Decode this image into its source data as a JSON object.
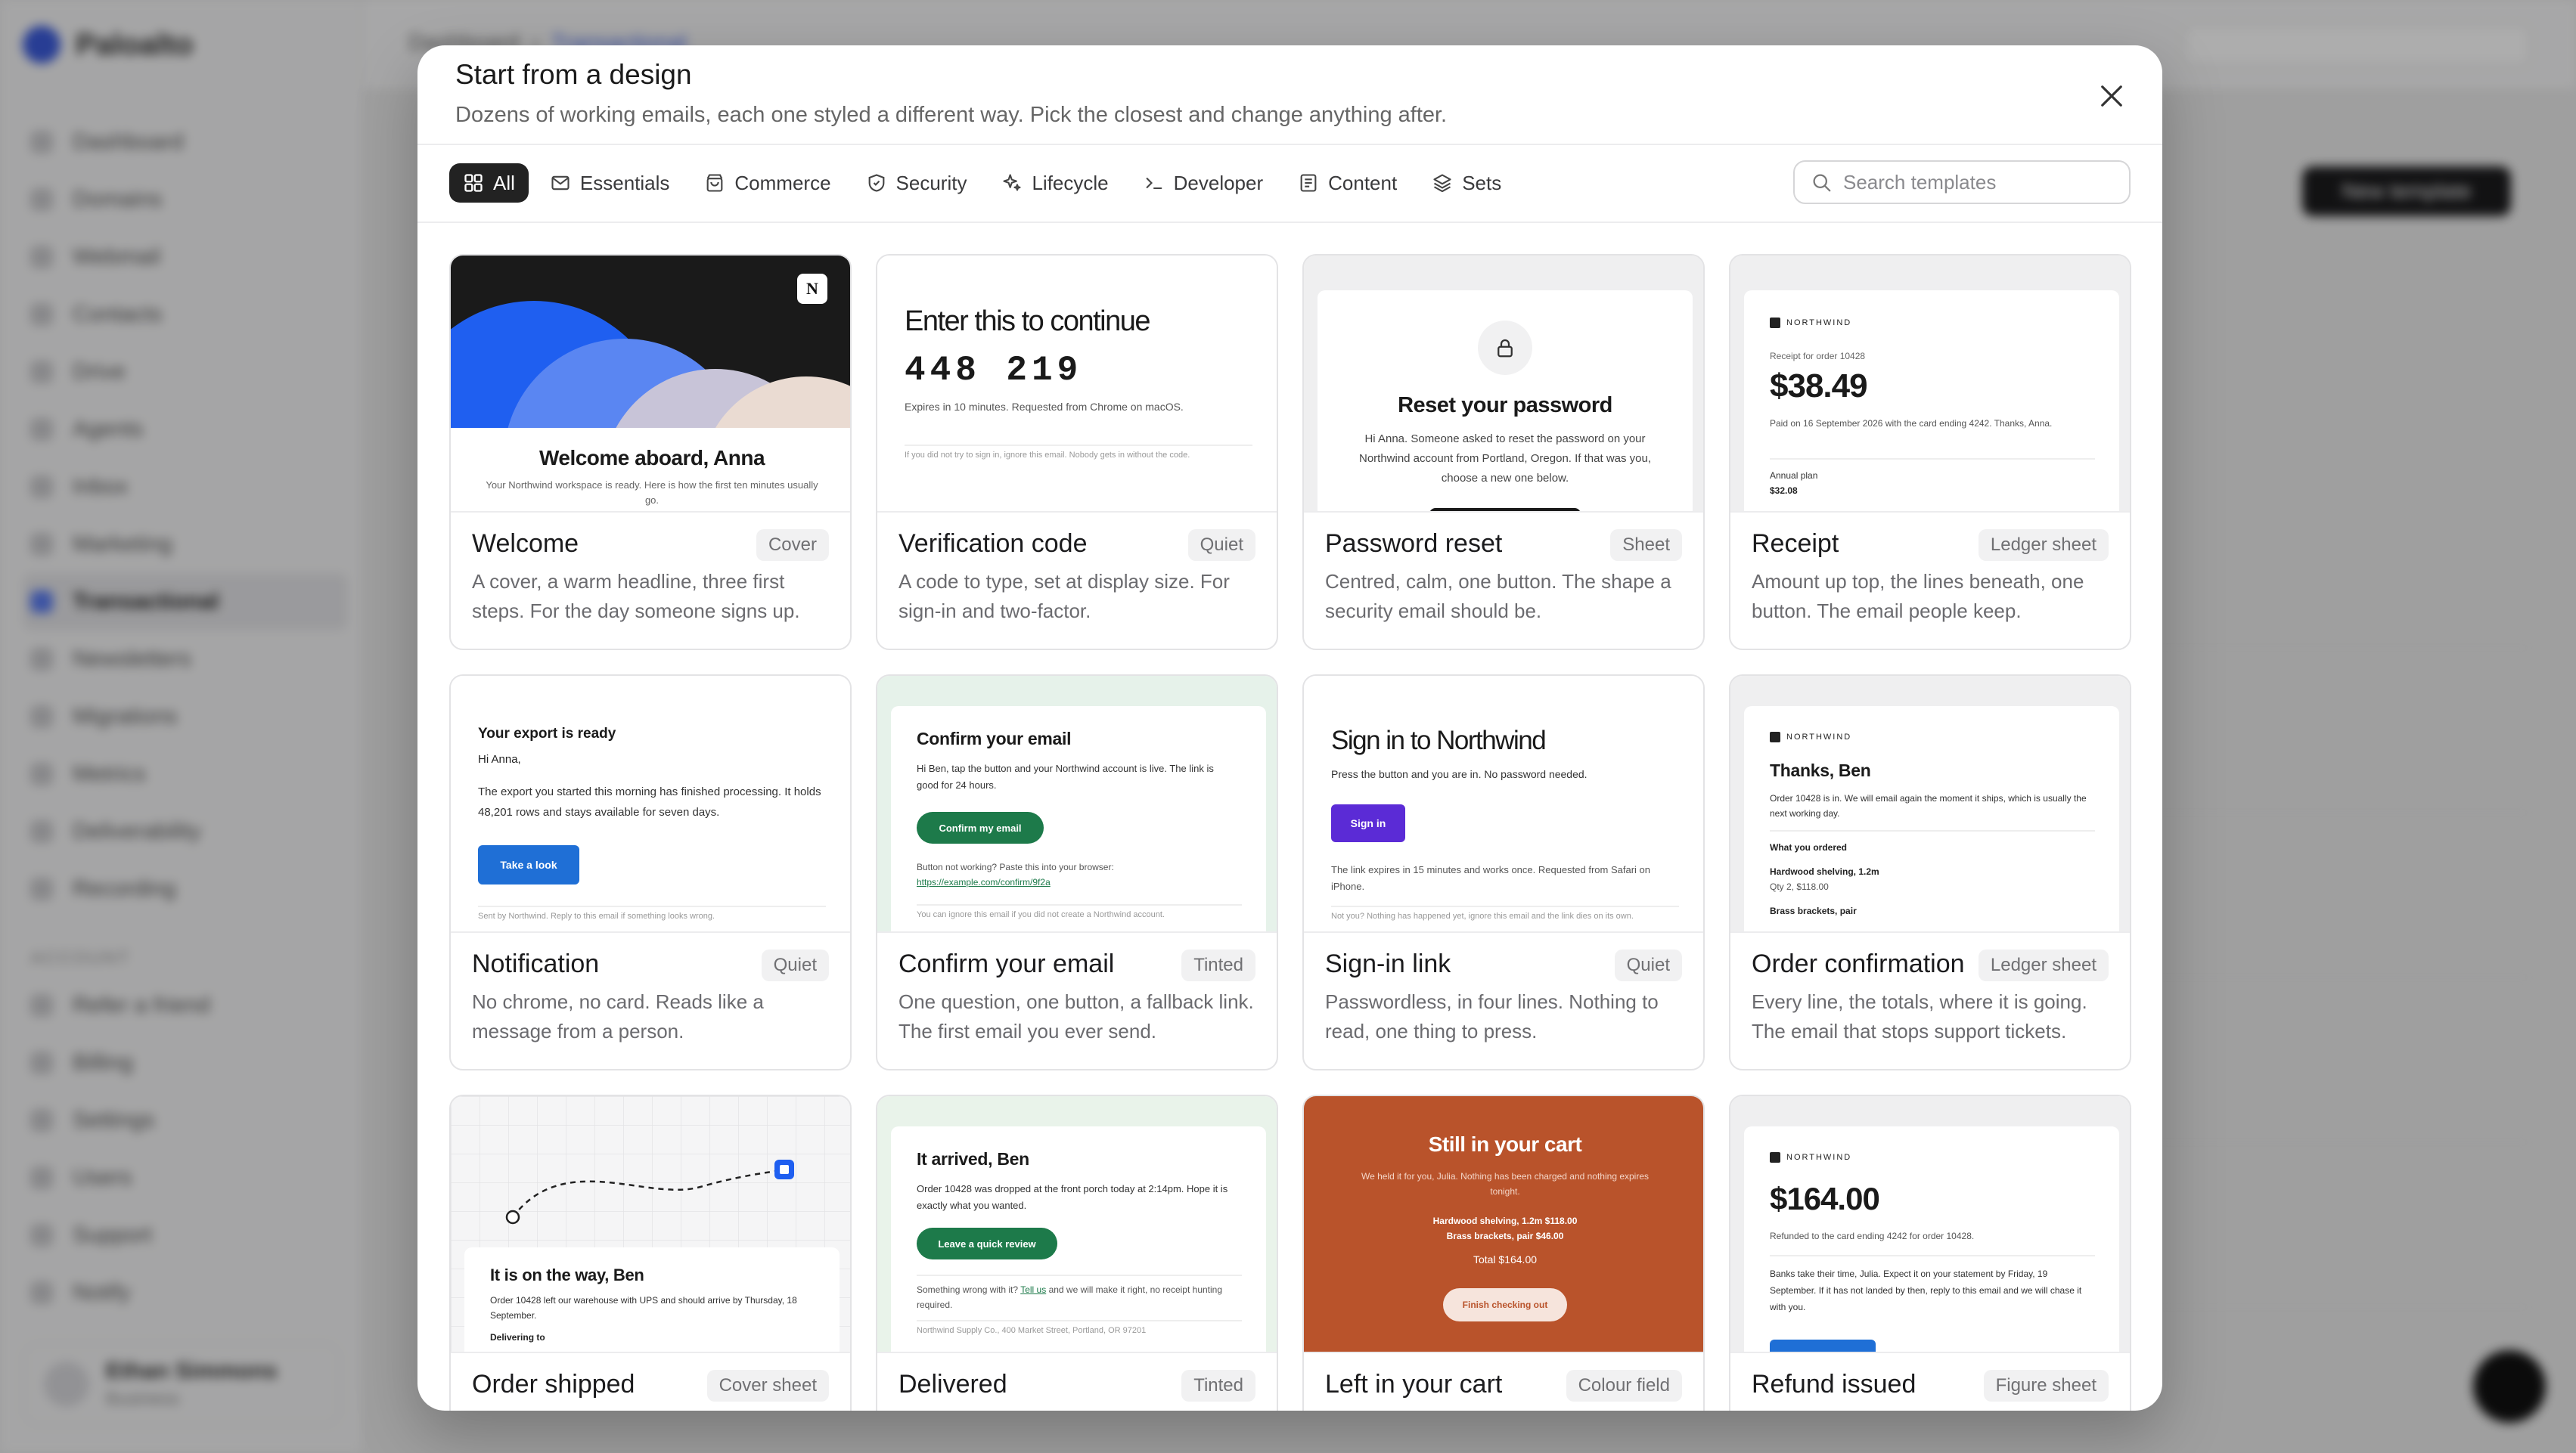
{
  "background": {
    "brand": "Paloalto",
    "nav": [
      "Dashboard",
      "Domains",
      "Webmail",
      "Contacts",
      "Drive",
      "Agents",
      "Inbox",
      "Marketing",
      "Transactional",
      "Newsletters",
      "Migrations",
      "Metrics",
      "Deliverability",
      "Recording"
    ],
    "account_section": "ACCOUNT",
    "account_nav": [
      "Refer a friend",
      "Billing",
      "Settings",
      "Users",
      "Support",
      "Notify"
    ],
    "breadcrumb": [
      "Dashboard",
      "Transactional"
    ],
    "user_name": "Ethan Simmons",
    "user_role": "Business",
    "new_button": "New template"
  },
  "modal": {
    "title": "Start from a design",
    "subtitle": "Dozens of working emails, each one styled a different way. Pick the closest and change anything after.",
    "search_placeholder": "Search templates",
    "filters": [
      {
        "label": "All",
        "icon": "grid-icon"
      },
      {
        "label": "Essentials",
        "icon": "mail-icon"
      },
      {
        "label": "Commerce",
        "icon": "bag-icon"
      },
      {
        "label": "Security",
        "icon": "shield-icon"
      },
      {
        "label": "Lifecycle",
        "icon": "sparkle-icon"
      },
      {
        "label": "Developer",
        "icon": "terminal-icon"
      },
      {
        "label": "Content",
        "icon": "document-icon"
      },
      {
        "label": "Sets",
        "icon": "layers-icon"
      }
    ]
  },
  "cards": [
    {
      "name": "Welcome",
      "tag": "Cover",
      "desc": "A cover, a warm headline, three first steps. For the day someone signs up.",
      "preview": {
        "logo": "N",
        "headline": "Welcome aboard, Anna",
        "body": "Your Northwind workspace is ready. Here is how the first ten minutes usually go."
      }
    },
    {
      "name": "Verification code",
      "tag": "Quiet",
      "desc": "A code to type, set at display size. For sign-in and two-factor.",
      "preview": {
        "headline": "Enter this to continue",
        "code": "448 219",
        "meta": "Expires in 10 minutes. Requested from Chrome on macOS.",
        "foot": "If you did not try to sign in, ignore this email. Nobody gets in without the code."
      }
    },
    {
      "name": "Password reset",
      "tag": "Sheet",
      "desc": "Centred, calm, one button. The shape a security email should be.",
      "preview": {
        "headline": "Reset your password",
        "body": "Hi Anna. Someone asked to reset the password on your Northwind account from Portland, Oregon. If that was you, choose a new one below."
      }
    },
    {
      "name": "Receipt",
      "tag": "Ledger sheet",
      "desc": "Amount up top, the lines beneath, one button. The email people keep.",
      "preview": {
        "brand": "NORTHWIND",
        "caption": "Receipt for order 10428",
        "amount": "$38.49",
        "body": "Paid on 16 September 2026 with the card ending 4242. Thanks, Anna.",
        "line_label": "Annual plan",
        "line_value": "$32.08"
      }
    },
    {
      "name": "Notification",
      "tag": "Quiet",
      "desc": "No chrome, no card. Reads like a message from a person.",
      "preview": {
        "headline": "Your export is ready",
        "greeting": "Hi Anna,",
        "body": "The export you started this morning has finished processing. It holds 48,201 rows and stays available for seven days.",
        "button": "Take a look",
        "foot": "Sent by Northwind. Reply to this email if something looks wrong."
      }
    },
    {
      "name": "Confirm your email",
      "tag": "Tinted",
      "desc": "One question, one button, a fallback link. The first email you ever send.",
      "preview": {
        "headline": "Confirm your email",
        "body": "Hi Ben, tap the button and your Northwind account is live. The link is good for 24 hours.",
        "button": "Confirm my email",
        "fallback": "Button not working? Paste this into your browser:",
        "link": "https://example.com/confirm/9f2a",
        "foot": "You can ignore this email if you did not create a Northwind account."
      }
    },
    {
      "name": "Sign-in link",
      "tag": "Quiet",
      "desc": "Passwordless, in four lines. Nothing to read, one thing to press.",
      "preview": {
        "headline": "Sign in to Northwind",
        "body": "Press the button and you are in. No password needed.",
        "button": "Sign in",
        "meta": "The link expires in 15 minutes and works once. Requested from Safari on iPhone.",
        "foot": "Not you? Nothing has happened yet, ignore this email and the link dies on its own."
      }
    },
    {
      "name": "Order confirmation",
      "tag": "Ledger sheet",
      "desc": "Every line, the totals, where it is going. The email that stops support tickets.",
      "preview": {
        "brand": "NORTHWIND",
        "headline": "Thanks, Ben",
        "body": "Order 10428 is in. We will email again the moment it ships, which is usually the next working day.",
        "section": "What you ordered",
        "item1": "Hardwood shelving, 1.2m",
        "item1_meta": "Qty 2, $118.00",
        "item2": "Brass brackets, pair"
      }
    },
    {
      "name": "Order shipped",
      "tag": "Cover sheet",
      "desc": "",
      "preview": {
        "headline": "It is on the way, Ben",
        "body": "Order 10428 left our warehouse with UPS and should arrive by Thursday, 18 September.",
        "sub": "Delivering to"
      }
    },
    {
      "name": "Delivered",
      "tag": "Tinted",
      "desc": "",
      "preview": {
        "headline": "It arrived, Ben",
        "body": "Order 10428 was dropped at the front porch today at 2:14pm. Hope it is exactly what you wanted.",
        "button": "Leave a quick review",
        "help_pre": "Something wrong with it?",
        "help_link": "Tell us",
        "help_post": "and we will make it right, no receipt hunting required.",
        "foot": "Northwind Supply Co., 400 Market Street, Portland, OR 97201"
      }
    },
    {
      "name": "Left in your cart",
      "tag": "Colour field",
      "desc": "",
      "preview": {
        "headline": "Still in your cart",
        "body": "We held it for you, Julia. Nothing has been charged and nothing expires tonight.",
        "item1": "Hardwood shelving, 1.2m $118.00",
        "item2": "Brass brackets, pair $46.00",
        "total": "Total $164.00",
        "button": "Finish checking out"
      }
    },
    {
      "name": "Refund issued",
      "tag": "Figure sheet",
      "desc": "",
      "preview": {
        "brand": "NORTHWIND",
        "amount": "$164.00",
        "caption": "Refunded to the card ending 4242 for order 10428.",
        "body": "Banks take their time, Julia. Expect it on your statement by Friday, 19 September. If it has not landed by then, reply to this email and we will chase it with you."
      }
    }
  ],
  "colors": {
    "accent_blue": "#1f6fd6",
    "green": "#1d7a4a",
    "purple": "#5b2bd6",
    "rust": "#b9532b",
    "ink": "#1b1b1d"
  }
}
